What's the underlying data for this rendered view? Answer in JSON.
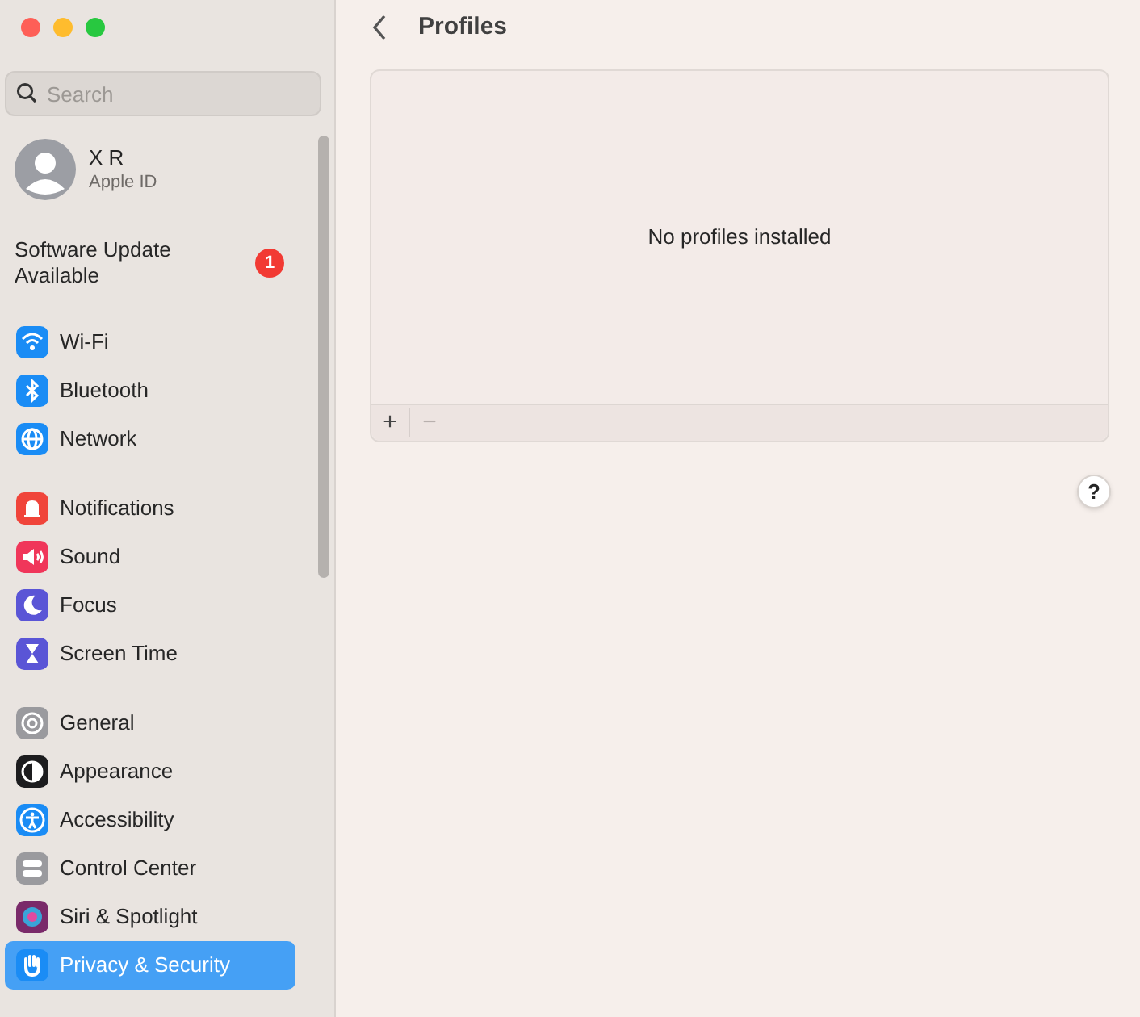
{
  "sidebar": {
    "search": {
      "placeholder": "Search"
    },
    "account": {
      "name": "X R",
      "subtitle": "Apple ID"
    },
    "update": {
      "label": "Software Update Available",
      "badge": "1"
    },
    "groups": [
      [
        {
          "label": "Wi-Fi",
          "color": "#1a8cf5",
          "selected": false
        },
        {
          "label": "Bluetooth",
          "color": "#1a8cf5",
          "selected": false
        },
        {
          "label": "Network",
          "color": "#1a8cf5",
          "selected": false
        }
      ],
      [
        {
          "label": "Notifications",
          "color": "#f0443a",
          "selected": false
        },
        {
          "label": "Sound",
          "color": "#f0365a",
          "selected": false
        },
        {
          "label": "Focus",
          "color": "#5a55d6",
          "selected": false
        },
        {
          "label": "Screen Time",
          "color": "#5a55d6",
          "selected": false
        }
      ],
      [
        {
          "label": "General",
          "color": "#9a9a9e",
          "selected": false
        },
        {
          "label": "Appearance",
          "color": "#1c1c1e",
          "selected": false
        },
        {
          "label": "Accessibility",
          "color": "#1a8cf5",
          "selected": false
        },
        {
          "label": "Control Center",
          "color": "#9a9a9e",
          "selected": false
        },
        {
          "label": "Siri & Spotlight",
          "color": "#7a2a6a",
          "selected": false
        },
        {
          "label": "Privacy & Security",
          "color": "#1a8cf5",
          "selected": true
        }
      ]
    ]
  },
  "page": {
    "title": "Profiles",
    "empty_message": "No profiles installed",
    "footer_buttons": [
      {
        "label": "+",
        "disabled": false
      },
      {
        "label": "−",
        "disabled": true
      }
    ],
    "help": "?"
  }
}
